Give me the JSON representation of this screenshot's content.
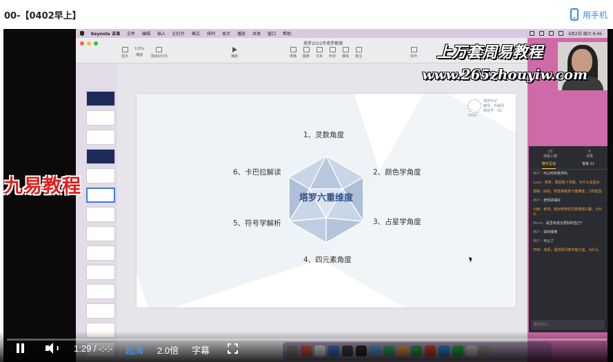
{
  "page": {
    "title": "00-【0402早上】",
    "mobile_label": "用手机"
  },
  "macbar": {
    "app": "Keynote 讲演",
    "menus": [
      "文件",
      "编辑",
      "插入",
      "幻灯片",
      "格式",
      "排列",
      "显示",
      "播放",
      "共享",
      "窗口",
      "帮助"
    ],
    "clock": "4月2日 周六 8:46"
  },
  "keynote": {
    "doc_title": "塔罗2022年塔罗教案",
    "toolbar_left": [
      {
        "label": "显示"
      },
      {
        "label": "缩放"
      },
      {
        "label": "添加幻灯片"
      }
    ],
    "toolbar_play": "播放",
    "toolbar_mid": [
      {
        "label": "表格"
      },
      {
        "label": "图表"
      },
      {
        "label": "文本"
      },
      {
        "label": "形状"
      },
      {
        "label": "媒体"
      },
      {
        "label": "批注"
      }
    ],
    "toolbar_right": "协作",
    "zoom": "125%"
  },
  "slide": {
    "center_title": "塔罗六重维度",
    "dimensions": [
      "1、灵数角度",
      "2、颜色学角度",
      "3、占星学角度",
      "4、四元素角度",
      "5、符号学解析",
      "6、卡巴拉解读"
    ],
    "logo_lines": [
      "塔罗日记",
      "教师：乔霖羽",
      "微信号：QL-XXXX"
    ]
  },
  "chat": {
    "stats": [
      {
        "value": "23",
        "label": "观看人数"
      },
      {
        "value": "0",
        "label": "点赞"
      }
    ],
    "tabs": [
      "聊天互动",
      "答疑 21"
    ],
    "messages": [
      {
        "user": "用户：",
        "text": "可以听到老师吗"
      },
      {
        "user": "",
        "text": "Lucy：老师，我回答了问题，为什么没显示",
        "orange": true
      },
      {
        "user": "",
        "text": "源缘：好的，我觉得塔罗六重维度，力所能及",
        "orange": true
      },
      {
        "user": "用户：",
        "text": "老师讲得好"
      },
      {
        "user": "",
        "text": "小雨：老师，我对塔罗的灵数很感兴趣，为什么",
        "orange": true
      },
      {
        "user": "Maria：",
        "text": "是否有成为更好的自己？"
      },
      {
        "user": "用户：",
        "text": "讲的很棒"
      },
      {
        "user": "用户：",
        "text": "可以了"
      },
      {
        "user": "",
        "text": "TME：老师，我觉得灵数学能力强，为什么",
        "orange": true
      }
    ],
    "input_placeholder": "说点什么..."
  },
  "watermarks": {
    "wm1": "上万套周易教程",
    "wm2": "www.265zhouyiw.com",
    "wm3": "九易教程"
  },
  "controls": {
    "time": "1:29 / -:-:-",
    "quality": "超清",
    "speed": "2.0倍",
    "subtitle": "字幕",
    "progress": 0.0
  },
  "colors": {
    "accent": "#2d8cf0",
    "slide_title": "#2f4f86",
    "chat_bg": "#2b2c31",
    "pink": "#cf6aa8"
  }
}
